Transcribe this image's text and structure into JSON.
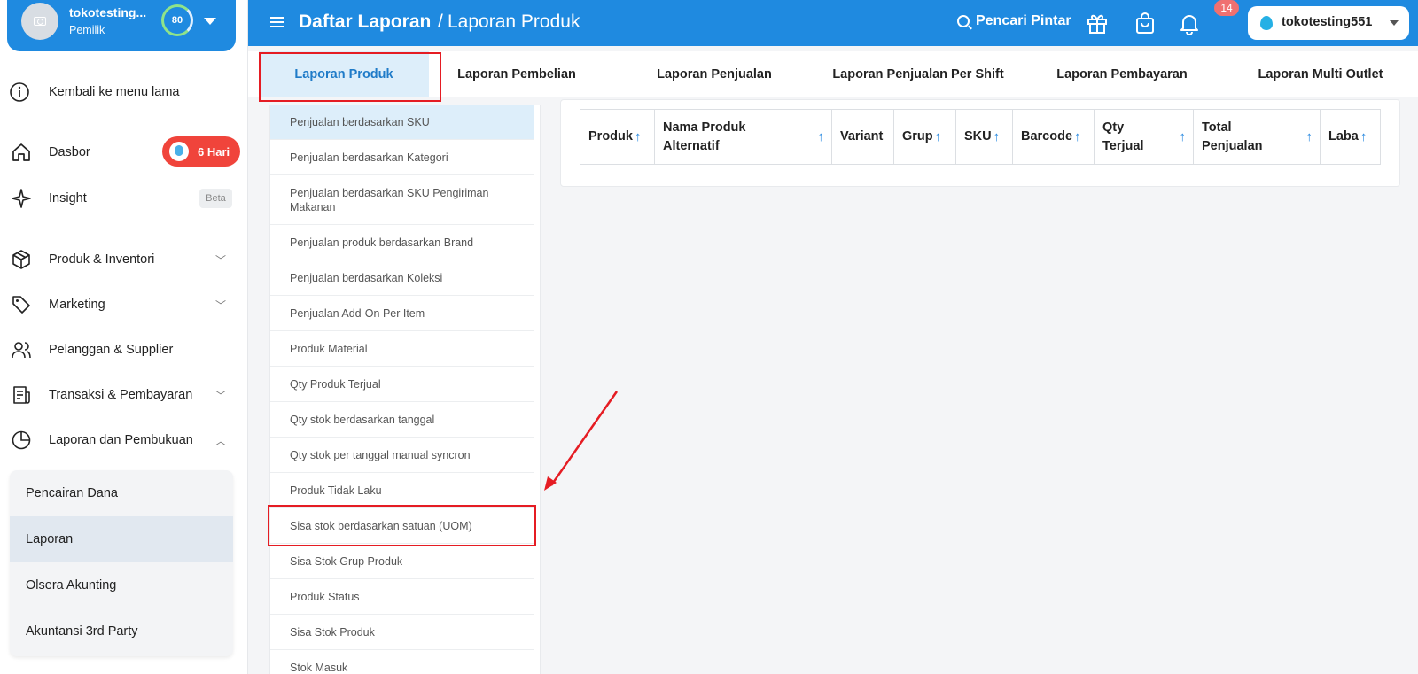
{
  "profile": {
    "store_name": "tokotesting...",
    "role": "Pemilik",
    "score": "80"
  },
  "sidebar": {
    "back_label": "Kembali ke menu lama",
    "dashboard": {
      "label": "Dasbor",
      "badge": "6 Hari"
    },
    "insight": {
      "label": "Insight",
      "badge": "Beta"
    },
    "items": [
      {
        "label": "Produk & Inventori",
        "icon": "box-icon"
      },
      {
        "label": "Marketing",
        "icon": "tag-icon"
      },
      {
        "label": "Pelanggan & Supplier",
        "icon": "users-icon"
      },
      {
        "label": "Transaksi & Pembayaran",
        "icon": "receipt-icon"
      },
      {
        "label": "Laporan dan Pembukuan",
        "icon": "pie-chart-icon"
      }
    ],
    "submenu": [
      "Pencairan Dana",
      "Laporan",
      "Olsera Akunting",
      "Akuntansi 3rd Party"
    ],
    "submenu_active": "Laporan"
  },
  "header": {
    "crumb_main": "Daftar Laporan",
    "crumb_sep": "/",
    "crumb_current": "Laporan Produk",
    "search_label": "Pencari Pintar",
    "notification_count": "14",
    "user": "tokotesting551"
  },
  "tabs": [
    "Laporan Produk",
    "Laporan Pembelian",
    "Laporan Penjualan",
    "Laporan Penjualan Per Shift",
    "Laporan Pembayaran",
    "Laporan Multi Outlet"
  ],
  "active_tab": "Laporan Produk",
  "report_list": [
    "Penjualan berdasarkan SKU",
    "Penjualan berdasarkan Kategori",
    "Penjualan berdasarkan SKU Pengiriman Makanan",
    "Penjualan produk berdasarkan Brand",
    "Penjualan berdasarkan Koleksi",
    "Penjualan Add-On Per Item",
    "Produk Material",
    "Qty Produk Terjual",
    "Qty stok berdasarkan tanggal",
    "Qty stok per tanggal manual syncron",
    "Produk Tidak Laku",
    "Sisa stok berdasarkan satuan (UOM)",
    "Sisa Stok Grup Produk",
    "Produk Status",
    "Sisa Stok Produk",
    "Stok Masuk"
  ],
  "table_columns": [
    "Produk",
    "Nama Produk Alternatif",
    "Variant",
    "Grup",
    "SKU",
    "Barcode",
    "Qty Terjual",
    "Total Penjualan",
    "Laba"
  ],
  "sort_arrow": "↑",
  "colors": {
    "primary": "#1f8ae0",
    "highlight": "#e51c23",
    "active_bg": "#ddeefa"
  }
}
